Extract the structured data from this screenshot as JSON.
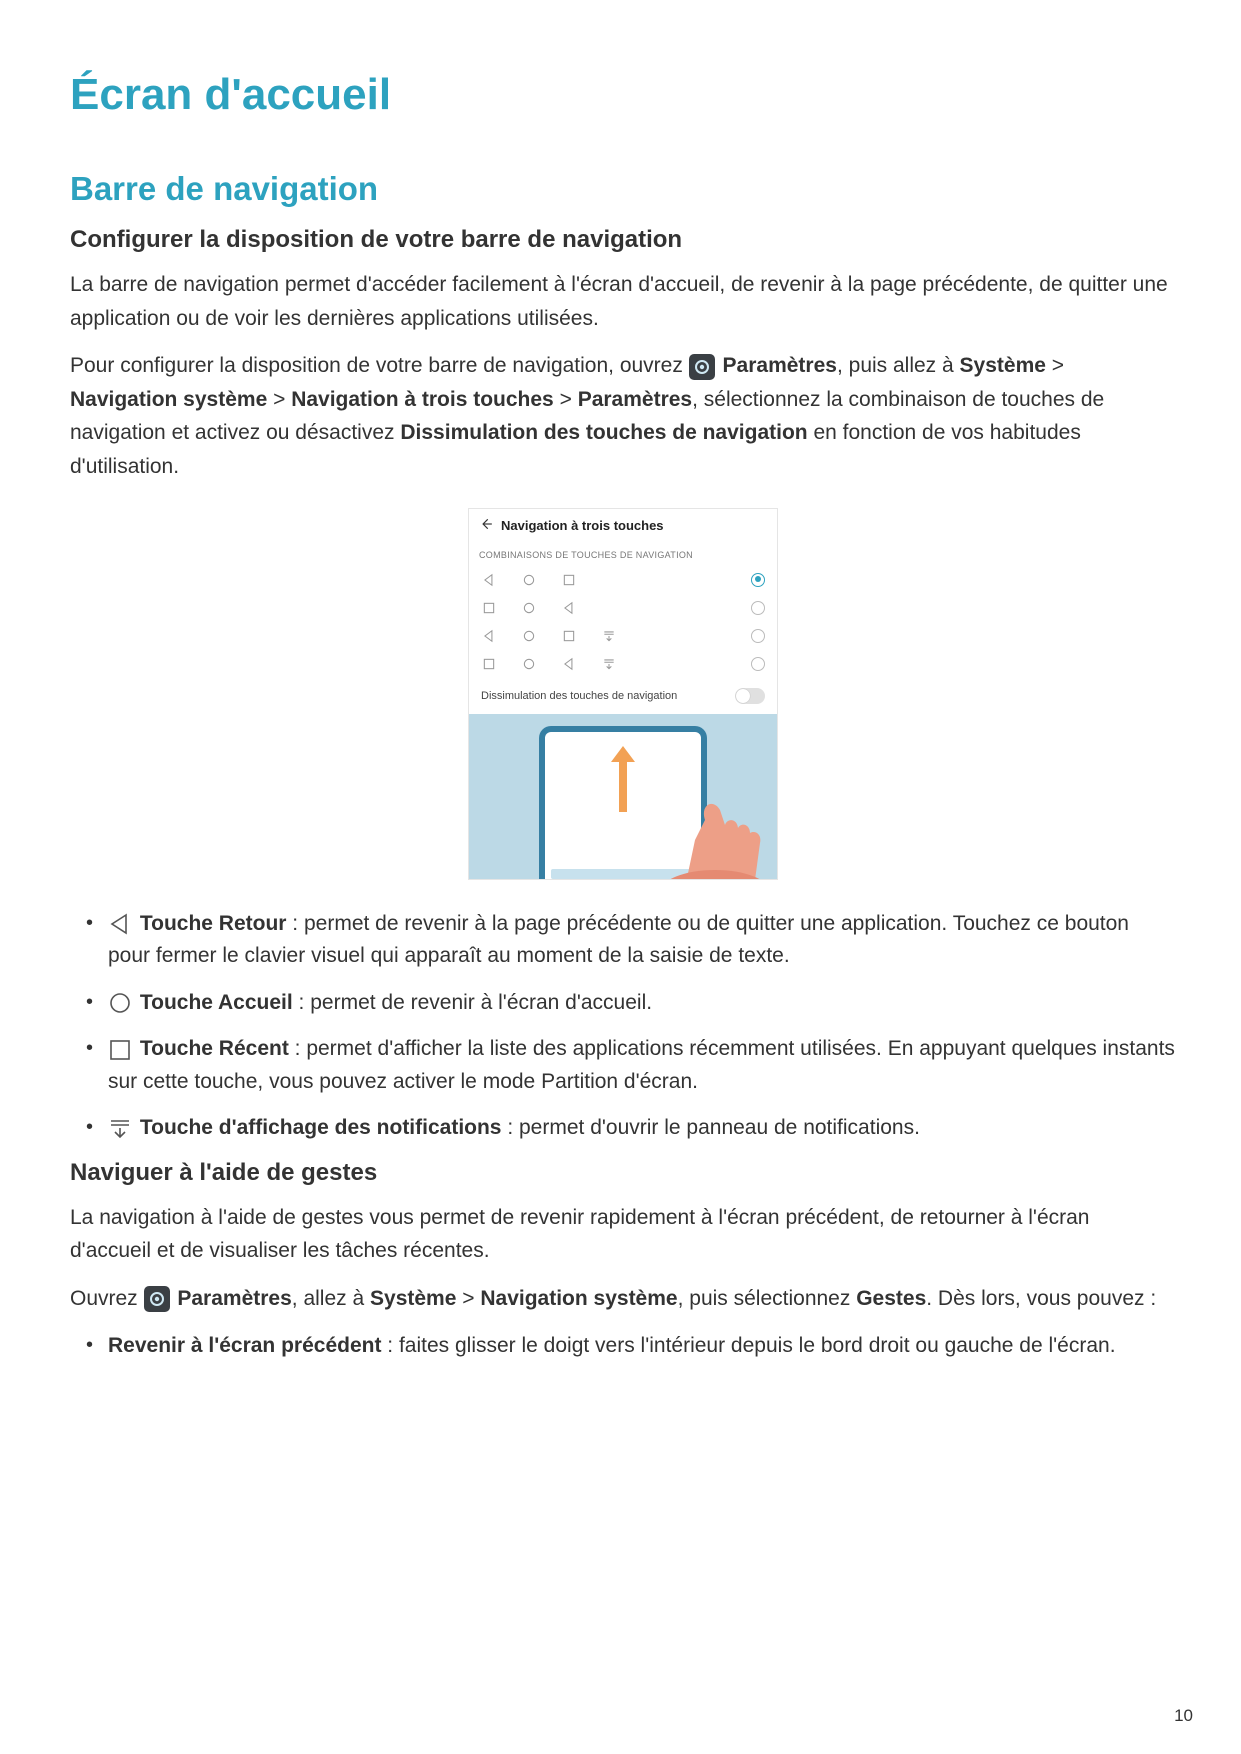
{
  "page_number": "10",
  "title": "Écran d'accueil",
  "section": "Barre de navigation",
  "sub1": {
    "heading": "Configurer la disposition de votre barre de navigation",
    "p1": "La barre de navigation permet d'accéder facilement à l'écran d'accueil, de revenir à la page précédente, de quitter une application ou de voir les dernières applications utilisées.",
    "p2a": "Pour configurer la disposition de votre barre de navigation, ouvrez ",
    "p2b": "Paramètres",
    "p2c": ", puis allez à ",
    "p2d": "Système",
    "p2e": " > ",
    "p2f": "Navigation système",
    "p2g": " > ",
    "p2h": "Navigation à trois touches",
    "p2i": " > ",
    "p2j": "Paramètres",
    "p2k": ", sélectionnez la combinaison de touches de navigation et activez ou désactivez ",
    "p2l": "Dissimulation des touches de navigation",
    "p2m": " en fonction de vos habitudes d'utilisation."
  },
  "screenshot": {
    "title": "Navigation à trois touches",
    "subtitle": "COMBINAISONS DE TOUCHES DE NAVIGATION",
    "toggle_label": "Dissimulation des touches de navigation"
  },
  "keys": {
    "back_title": "Touche Retour",
    "back_desc": " : permet de revenir à la page précédente ou de quitter une application. Touchez ce bouton pour fermer le clavier visuel qui apparaît au moment de la saisie de texte.",
    "home_title": "Touche Accueil",
    "home_desc": " : permet de revenir à l'écran d'accueil.",
    "recent_title": "Touche Récent",
    "recent_desc": " : permet d'afficher la liste des applications récemment utilisées. En appuyant quelques instants sur cette touche, vous pouvez activer le mode Partition d'écran.",
    "notif_title": "Touche d'affichage des notifications",
    "notif_desc": " : permet d'ouvrir le panneau de notifications."
  },
  "sub2": {
    "heading": "Naviguer à l'aide de gestes",
    "p1": "La navigation à l'aide de gestes vous permet de revenir rapidement à l'écran précédent, de retourner à l'écran d'accueil et de visualiser les tâches récentes.",
    "p2a": "Ouvrez ",
    "p2b": "Paramètres",
    "p2c": ", allez à ",
    "p2d": "Système",
    "p2e": " > ",
    "p2f": "Navigation système",
    "p2g": ", puis sélectionnez ",
    "p2h": "Gestes",
    "p2i": ". Dès lors, vous pouvez :",
    "b1a": "Revenir à l'écran précédent",
    "b1b": " : faites glisser le doigt vers l'intérieur depuis le bord droit ou gauche de l'écran."
  }
}
